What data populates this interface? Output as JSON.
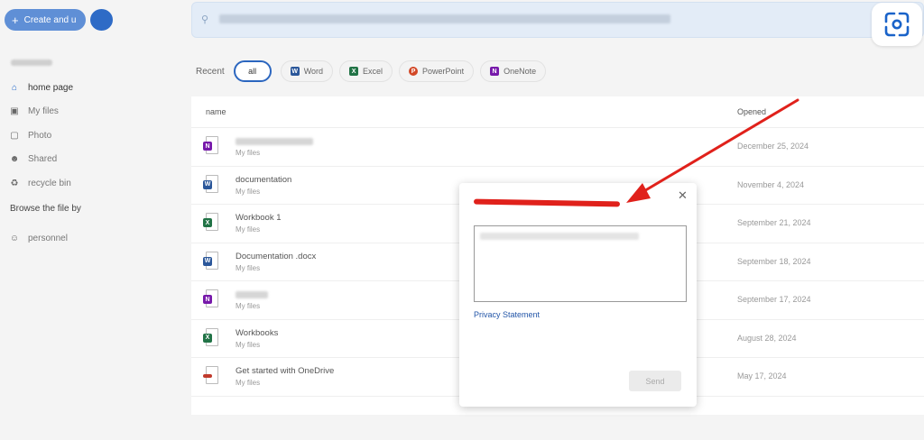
{
  "sidebar": {
    "create_label": "Create and u",
    "nav": [
      {
        "label": "home page",
        "icon": "home-icon"
      },
      {
        "label": "My files",
        "icon": "folder-icon"
      },
      {
        "label": "Photo",
        "icon": "photo-icon"
      },
      {
        "label": "Shared",
        "icon": "people-icon"
      },
      {
        "label": "recycle bin",
        "icon": "trash-icon"
      }
    ],
    "browse_title": "Browse the file by",
    "people_label": "personnel"
  },
  "filters": {
    "recent_label": "Recent",
    "chips": [
      {
        "label": "all"
      },
      {
        "label": "Word",
        "app": "W",
        "color": "#2b579a"
      },
      {
        "label": "Excel",
        "app": "X",
        "color": "#217346"
      },
      {
        "label": "PowerPoint",
        "app": "P",
        "color": "#d24726"
      },
      {
        "label": "OneNote",
        "app": "N",
        "color": "#7719aa"
      }
    ]
  },
  "list": {
    "col_name": "name",
    "col_opened": "Opened",
    "rows": [
      {
        "name": "",
        "location": "My files",
        "date": "December 25, 2024",
        "app": "N",
        "color": "#7719aa"
      },
      {
        "name": "documentation",
        "location": "My files",
        "date": "November 4, 2024",
        "app": "W",
        "color": "#2b579a"
      },
      {
        "name": "Workbook 1",
        "location": "My files",
        "date": "September 21, 2024",
        "app": "X",
        "color": "#217346"
      },
      {
        "name": "Documentation .docx",
        "location": "My files",
        "date": "September 18, 2024",
        "app": "W",
        "color": "#2b579a"
      },
      {
        "name": "",
        "location": "My files",
        "date": "September 17, 2024",
        "app": "N",
        "color": "#7719aa"
      },
      {
        "name": "Workbooks",
        "location": "My files",
        "date": "August 28, 2024",
        "app": "X",
        "color": "#217346"
      },
      {
        "name": "Get started with OneDrive",
        "location": "My files",
        "date": "May 17, 2024",
        "app": "",
        "color": "#c0392b"
      }
    ]
  },
  "dialog": {
    "title": "",
    "privacy_label": "Privacy Statement",
    "send_label": "Send"
  }
}
